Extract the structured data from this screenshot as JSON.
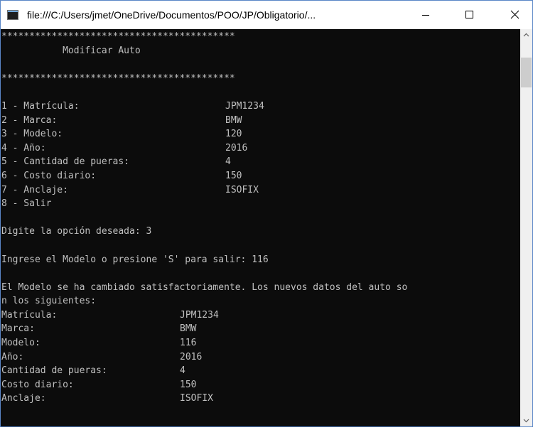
{
  "window": {
    "title": "file:///C:/Users/jmet/OneDrive/Documentos/POO/JP/Obligatorio/..."
  },
  "console": {
    "lines": [
      [
        "******************************************"
      ],
      [
        "           Modificar Auto"
      ],
      [
        ""
      ],
      [
        "******************************************"
      ],
      [
        ""
      ],
      [
        "1 - Matrícula:",
        "JPM1234"
      ],
      [
        "2 - Marca:",
        "BMW"
      ],
      [
        "3 - Modelo:",
        "120"
      ],
      [
        "4 - Año:",
        "2016"
      ],
      [
        "5 - Cantidad de pueras:",
        "4"
      ],
      [
        "6 - Costo diario:",
        "150"
      ],
      [
        "7 - Anclaje:",
        "ISOFIX"
      ],
      [
        "8 - Salir"
      ],
      [
        ""
      ],
      [
        "Digite la opción deseada: 3"
      ],
      [
        ""
      ],
      [
        "Ingrese el Modelo o presione 'S' para salir: 116"
      ],
      [
        ""
      ],
      [
        "El Modelo se ha cambiado satisfactoriamente. Los nuevos datos del auto so"
      ],
      [
        "n los siguientes:"
      ],
      [
        "Matrícula:",
        "JPM1234"
      ],
      [
        "Marca:",
        "BMW"
      ],
      [
        "Modelo:",
        "116"
      ],
      [
        "Año:",
        "2016"
      ],
      [
        "Cantidad de pueras:",
        "4"
      ],
      [
        "Costo diario:",
        "150"
      ],
      [
        "Anclaje:",
        "ISOFIX"
      ]
    ]
  },
  "colors": {
    "console_bg": "#0c0c0c",
    "console_text": "#c0c0c0"
  }
}
